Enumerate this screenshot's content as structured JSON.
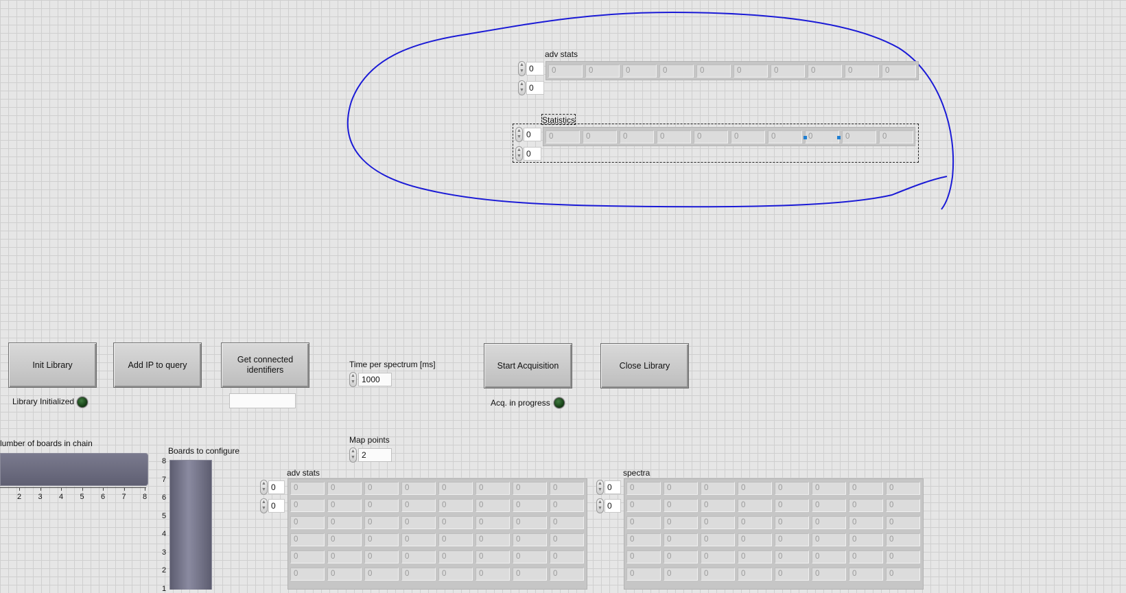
{
  "top_group": {
    "adv_stats": {
      "label": "adv stats",
      "index0": "0",
      "index1": "0",
      "cells": [
        "0",
        "0",
        "0",
        "0",
        "0",
        "0",
        "0",
        "0",
        "0",
        "0"
      ]
    },
    "statistics": {
      "label": "Statistics",
      "index0": "0",
      "index1": "0",
      "cells": [
        "0",
        "0",
        "0",
        "0",
        "0",
        "0",
        "0",
        "0",
        "0",
        "0"
      ]
    }
  },
  "buttons": {
    "init_library": "Init Library",
    "add_ip": "Add IP to query",
    "get_connected": "Get connected identifiers",
    "start_acq": "Start Acquisition",
    "close_library": "Close Library"
  },
  "indicators": {
    "library_initialized": "Library Initialized",
    "acq_in_progress": "Acq. in progress",
    "identifiers_value": ""
  },
  "controls": {
    "time_per_spectrum_label": "Time per spectrum [ms]",
    "time_per_spectrum_value": "1000",
    "map_points_label": "Map points",
    "map_points_value": "2",
    "number_of_boards_label": "lumber of boards in chain",
    "number_of_boards_ticks": [
      "2",
      "3",
      "4",
      "5",
      "6",
      "7",
      "8"
    ],
    "boards_to_configure_label": "Boards to configure",
    "boards_to_configure_ticks": [
      "8",
      "7",
      "6",
      "5",
      "4",
      "3",
      "2",
      "1"
    ]
  },
  "bottom_adv_stats": {
    "label": "adv stats",
    "index0": "0",
    "index1": "0",
    "rows": [
      [
        "0",
        "0",
        "0",
        "0",
        "0",
        "0",
        "0",
        "0"
      ],
      [
        "0",
        "0",
        "0",
        "0",
        "0",
        "0",
        "0",
        "0"
      ],
      [
        "0",
        "0",
        "0",
        "0",
        "0",
        "0",
        "0",
        "0"
      ],
      [
        "0",
        "0",
        "0",
        "0",
        "0",
        "0",
        "0",
        "0"
      ],
      [
        "0",
        "0",
        "0",
        "0",
        "0",
        "0",
        "0",
        "0"
      ],
      [
        "0",
        "0",
        "0",
        "0",
        "0",
        "0",
        "0",
        "0"
      ]
    ]
  },
  "spectra": {
    "label": "spectra",
    "index0": "0",
    "index1": "0",
    "rows": [
      [
        "0",
        "0",
        "0",
        "0",
        "0",
        "0",
        "0",
        "0"
      ],
      [
        "0",
        "0",
        "0",
        "0",
        "0",
        "0",
        "0",
        "0"
      ],
      [
        "0",
        "0",
        "0",
        "0",
        "0",
        "0",
        "0",
        "0"
      ],
      [
        "0",
        "0",
        "0",
        "0",
        "0",
        "0",
        "0",
        "0"
      ],
      [
        "0",
        "0",
        "0",
        "0",
        "0",
        "0",
        "0",
        "0"
      ],
      [
        "0",
        "0",
        "0",
        "0",
        "0",
        "0",
        "0",
        "0"
      ]
    ]
  },
  "colors": {
    "annotation": "#1a1ad6",
    "slider_fill": "#6c6c80",
    "led_off": "#1e4d1e"
  }
}
